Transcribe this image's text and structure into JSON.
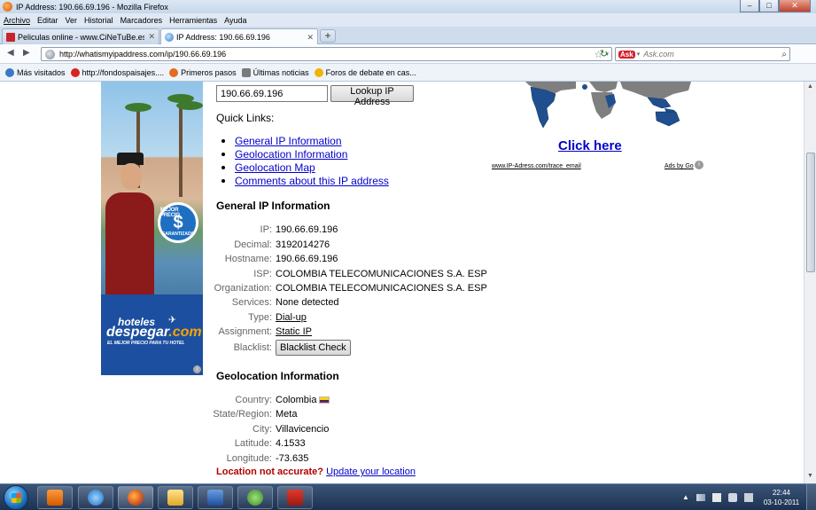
{
  "window": {
    "title": "IP Address: 190.66.69.196 - Mozilla Firefox",
    "minimize": "–",
    "maximize": "□",
    "close": "✕"
  },
  "menu": [
    "Archivo",
    "Editar",
    "Ver",
    "Historial",
    "Marcadores",
    "Herramientas",
    "Ayuda"
  ],
  "tabs": [
    {
      "label": "Peliculas online - www.CiNeTuBe.es. ...",
      "close": "✕",
      "icon": "cinetube-favicon"
    },
    {
      "label": "IP Address: 190.66.69.196",
      "close": "✕",
      "icon": "globe-favicon"
    }
  ],
  "new_tab": "+",
  "nav": {
    "back": "◀",
    "forward": "▶",
    "url": "http://whatismyipaddress.com/ip/190.66.69.196",
    "star": "☆",
    "dropdown": "▾",
    "reload": "↻",
    "search_engine": "Ask",
    "search_placeholder": "Ask.com",
    "search_icon": "⌕"
  },
  "bookmarks": [
    {
      "label": "Más visitados",
      "icon": "firefox-icon",
      "color": "#3b79c4"
    },
    {
      "label": "http://fondospaisajes....",
      "icon": "flower-icon",
      "color": "#d9231e"
    },
    {
      "label": "Primeros pasos",
      "icon": "firefox-icon",
      "color": "#e46b1f"
    },
    {
      "label": "Últimas noticias",
      "icon": "rss-icon",
      "color": "#7a7a7a"
    },
    {
      "label": "Foros de debate en cas...",
      "icon": "forum-icon",
      "color": "#f0b400"
    }
  ],
  "left_ad": {
    "badge_top": "MEJOR PRECIO",
    "badge_symbol": "$",
    "badge_bottom": "GARANTIZADO",
    "brand_small": "hoteles",
    "brand_big": "despegar",
    "brand_dotcom": ".com",
    "tagline": "EL MEJOR PRECIO PARA TU HOTEL",
    "info": "i"
  },
  "lookup": {
    "ip_value": "190.66.69.196",
    "button": "Lookup IP Address"
  },
  "quick_links": {
    "title": "Quick Links:",
    "items": [
      "General IP Information",
      "Geolocation Information",
      "Geolocation Map",
      "Comments about this IP address"
    ]
  },
  "general": {
    "title": "General IP Information",
    "rows": [
      {
        "key": "IP:",
        "value": "190.66.69.196"
      },
      {
        "key": "Decimal:",
        "value": "3192014276"
      },
      {
        "key": "Hostname:",
        "value": "190.66.69.196"
      },
      {
        "key": "ISP:",
        "value": "COLOMBIA TELECOMUNICACIONES S.A. ESP"
      },
      {
        "key": "Organization:",
        "value": "COLOMBIA TELECOMUNICACIONES S.A. ESP"
      },
      {
        "key": "Services:",
        "value": "None detected"
      },
      {
        "key": "Type:",
        "value": "Dial-up"
      },
      {
        "key": "Assignment:",
        "value": "Static IP"
      },
      {
        "key": "Blacklist:",
        "value": "Blacklist Check"
      }
    ]
  },
  "geo": {
    "title": "Geolocation Information",
    "rows": [
      {
        "key": "Country:",
        "value": "Colombia"
      },
      {
        "key": "State/Region:",
        "value": "Meta"
      },
      {
        "key": "City:",
        "value": "Villavicencio"
      },
      {
        "key": "Latitude:",
        "value": "4.1533"
      },
      {
        "key": "Longitude:",
        "value": "-73.635"
      }
    ],
    "accuracy_warning": "Location not accurate?",
    "accuracy_link": "Update your location"
  },
  "right_ad": {
    "cta": "Click here",
    "source": "www.IP-Adress.com/trace_email",
    "ads_by": "Ads by Go",
    "info": "i"
  },
  "taskbar": {
    "apps": [
      "windows-media-player-icon",
      "internet-explorer-icon",
      "firefox-icon",
      "file-explorer-icon",
      "word-icon",
      "messenger-icon",
      "acrobat-reader-icon"
    ],
    "time": "22:44",
    "date": "03-10-2011"
  },
  "colors": {
    "link": "#0000cc",
    "warning": "#b00000",
    "ad_blue": "#1c4fa0",
    "map_water": "#ffffff",
    "map_land": "#7f7f7f",
    "map_highlight": "#1f4f8f"
  }
}
